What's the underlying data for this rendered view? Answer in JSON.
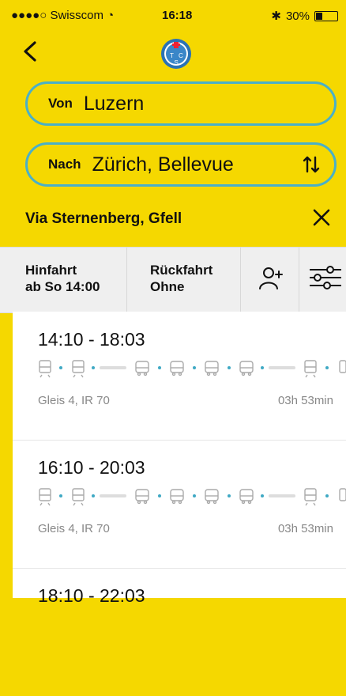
{
  "status": {
    "carrier": "●●●●○ Swisscom",
    "time": "16:18",
    "battery": "30%"
  },
  "search": {
    "from_label": "Von",
    "from_value": "Luzern",
    "to_label": "Nach",
    "to_value": "Zürich, Bellevue",
    "via": "Via Sternenberg, Gfell"
  },
  "tabs": {
    "outbound_label": "Hinfahrt",
    "outbound_value": "ab So 14:00",
    "return_label": "Rückfahrt",
    "return_value": "Ohne"
  },
  "connections": [
    {
      "times": "14:10 - 18:03",
      "platform": "Gleis 4, IR 70",
      "duration": "03h 53min"
    },
    {
      "times": "16:10 - 20:03",
      "platform": "Gleis 4, IR 70",
      "duration": "03h 53min"
    },
    {
      "times": "18:10 - 22:03",
      "platform": "",
      "duration": ""
    }
  ],
  "colors": {
    "background": "#f5d800",
    "field_border": "#4ab0c8",
    "accent_dot": "#3fa9c4"
  },
  "icons": [
    "back-arrow-icon",
    "tcs-logo-icon",
    "swap-icon",
    "close-icon",
    "add-person-icon",
    "filter-icon",
    "train-icon",
    "bus-icon"
  ]
}
